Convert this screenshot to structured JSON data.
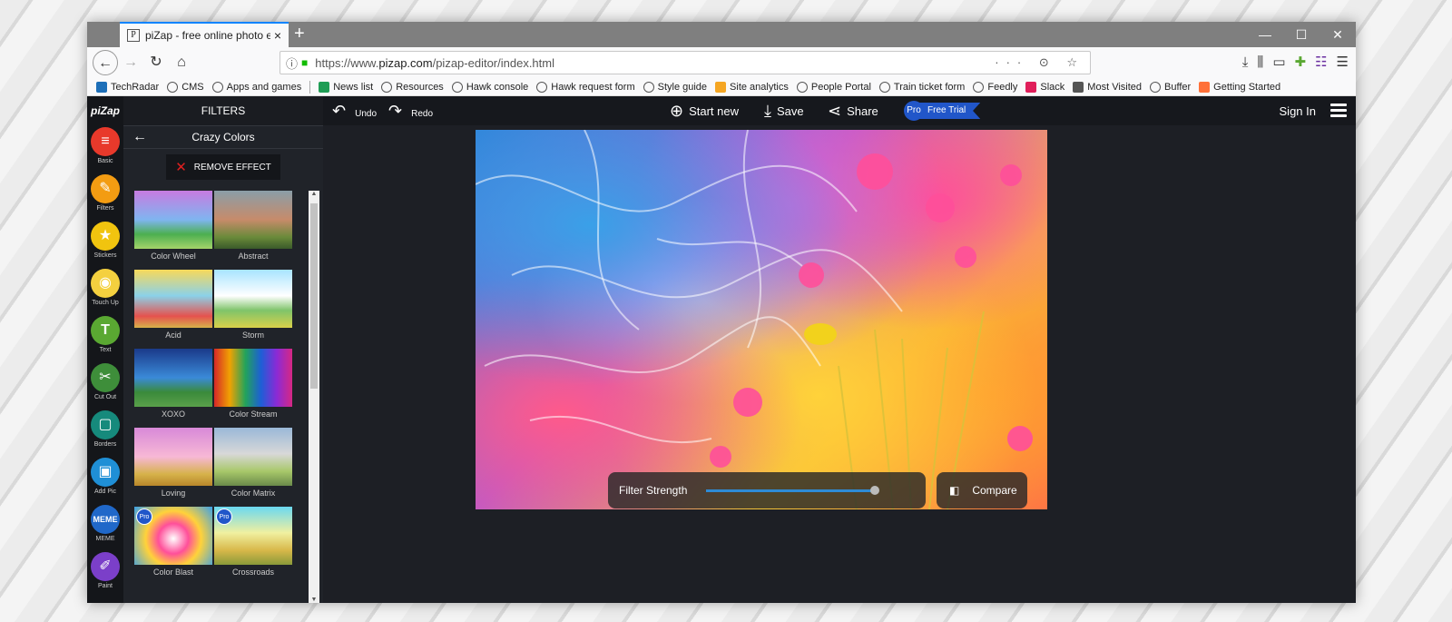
{
  "browser": {
    "tab_favicon": "P",
    "tab_title": "piZap - free online photo editor",
    "tab_close": "×",
    "new_tab": "+",
    "window_controls": [
      "—",
      "☐",
      "✕"
    ],
    "url_prefix": "https://www.",
    "url_host": "pizap.com",
    "url_path": "/pizap-editor/index.html",
    "page_actions": "··· ⊙ ☆",
    "right_tools": [
      "⤓",
      "⫼",
      "▭",
      "✚",
      "☷",
      "☰"
    ],
    "bookmarks": [
      {
        "label": "TechRadar",
        "icon": "techradar-icon"
      },
      {
        "label": "CMS",
        "icon": "globe-icon"
      },
      {
        "label": "Apps and games",
        "icon": "globe-icon"
      },
      {
        "label": "News list",
        "icon": "sheet-icon"
      },
      {
        "label": "Resources",
        "icon": "globe-icon"
      },
      {
        "label": "Hawk console",
        "icon": "globe-icon"
      },
      {
        "label": "Hawk request form",
        "icon": "globe-icon"
      },
      {
        "label": "Style guide",
        "icon": "globe-icon"
      },
      {
        "label": "Site analytics",
        "icon": "analytics-icon"
      },
      {
        "label": "People Portal",
        "icon": "globe-icon"
      },
      {
        "label": "Train ticket form",
        "icon": "globe-icon"
      },
      {
        "label": "Feedly",
        "icon": "globe-icon"
      },
      {
        "label": "Slack",
        "icon": "slack-icon"
      },
      {
        "label": "Most Visited",
        "icon": "gear-icon"
      },
      {
        "label": "Buffer",
        "icon": "globe-icon"
      },
      {
        "label": "Getting Started",
        "icon": "firefox-icon"
      }
    ]
  },
  "app": {
    "logo": "piZap",
    "toolbar": {
      "undo": "Undo",
      "redo": "Redo",
      "start_new": "Start new",
      "save": "Save",
      "share": "Share",
      "pro_badge": "Pro",
      "free_trial": "Free Trial",
      "sign_in": "Sign In"
    },
    "rail": [
      {
        "label": "Basic",
        "color": "#e8392b",
        "glyph": "≡"
      },
      {
        "label": "Filters",
        "color": "#f39c12",
        "glyph": "✎"
      },
      {
        "label": "Stickers",
        "color": "#f1c40f",
        "glyph": "★"
      },
      {
        "label": "Touch Up",
        "color": "#f4d03f",
        "glyph": "◉"
      },
      {
        "label": "Text",
        "color": "#5aa832",
        "glyph": "T"
      },
      {
        "label": "Cut Out",
        "color": "#3e8e3a",
        "glyph": "✂"
      },
      {
        "label": "Borders",
        "color": "#168a7c",
        "glyph": "▢"
      },
      {
        "label": "Add Pic",
        "color": "#1f8fd6",
        "glyph": "▣"
      },
      {
        "label": "MEME",
        "color": "#2068c9",
        "glyph": "MEME"
      },
      {
        "label": "Paint",
        "color": "#7b3fc9",
        "glyph": "✐"
      }
    ],
    "panel": {
      "title": "FILTERS",
      "category": "Crazy Colors",
      "remove_effect": "REMOVE EFFECT",
      "filters": [
        {
          "label": "Color Wheel",
          "pro": false
        },
        {
          "label": "Abstract",
          "pro": false
        },
        {
          "label": "Acid",
          "pro": false
        },
        {
          "label": "Storm",
          "pro": false
        },
        {
          "label": "XOXO",
          "pro": false
        },
        {
          "label": "Color Stream",
          "pro": false
        },
        {
          "label": "Loving",
          "pro": false
        },
        {
          "label": "Color Matrix",
          "pro": false
        },
        {
          "label": "Color Blast",
          "pro": true
        },
        {
          "label": "Crossroads",
          "pro": true
        }
      ],
      "pro_tag": "Pro"
    },
    "filter_strength_label": "Filter Strength",
    "filter_strength": 0.98,
    "compare_label": "Compare"
  }
}
